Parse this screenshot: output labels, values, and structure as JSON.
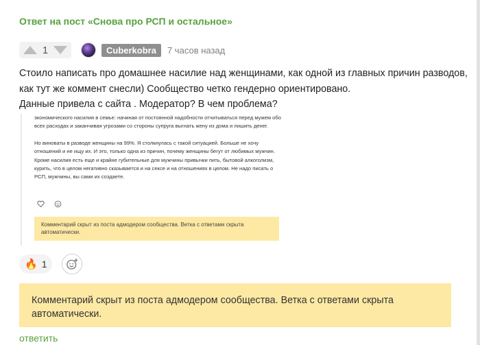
{
  "header": {
    "reply_link": "Ответ на пост «Снова про РСП и остальное»"
  },
  "comment": {
    "rating": "1",
    "username": "Cuberkobra",
    "time": "7 часов назад",
    "text": [
      "Стоило написать про домашнее насилие над женщинами, как одной из главных причин разводов, как тут же коммент снесли) Сообщество четко гендерно ориентировано.",
      "Данные привела с сайта . Модератор? В чем проблема?"
    ]
  },
  "embed": {
    "paragraphs": [
      "экономического насилия в семье: начиная от постоянной надобности отчитываться перед мужем обо всех расходах и заканчивая угрозами со стороны супруга выгнать жену из дома и лишить денег.",
      "Но виноваты в разводе женщины на 99%. Я столкнулась с такой ситуацией. Больше не хочу отношений и не ищу их. И это, только одна из причин, почему женщины бегут от любимых мужчин. Кроме насилия есть еще и крайне губительные для мужчины привычки пить, бытовой алкоголизм, курить, что в целом негативно сказывается и на сексе и на отношениях в целом. Не надо писать о РСП, мужчины, вы сами их создаете."
    ],
    "notice": "Комментарий скрыт из поста адмодером сообщества. Ветка с ответами скрыта автоматически."
  },
  "reactions": {
    "fire_count": "1",
    "fire_emoji": "🔥"
  },
  "notice": "Комментарий скрыт из поста адмодером сообщества. Ветка с ответами скрыта автоматически.",
  "actions": {
    "reply": "ответить"
  },
  "colors": {
    "link_green": "#57a23d",
    "notice_yellow": "#fde9a4",
    "username_bg": "#8f8f8f"
  },
  "icons": {
    "upvote": "arrow-up-icon",
    "downvote": "arrow-down-icon",
    "add_reaction": "smile-plus-icon",
    "like": "heart-icon",
    "emoji": "smile-icon"
  }
}
